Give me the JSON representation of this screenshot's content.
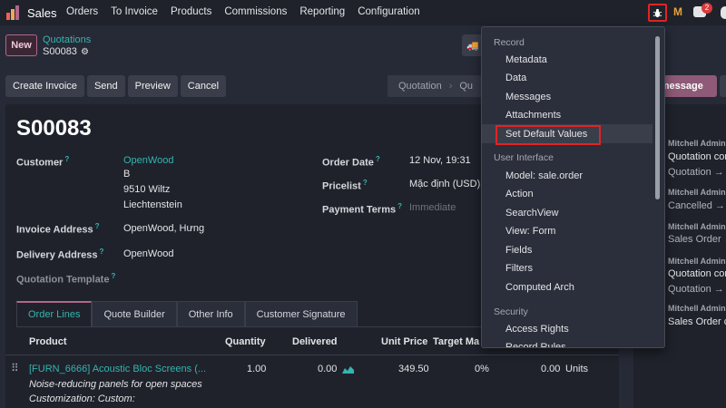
{
  "navbar": {
    "app_name": "Sales",
    "menu": [
      "Orders",
      "To Invoice",
      "Products",
      "Commissions",
      "Reporting",
      "Configuration"
    ],
    "debug_icon": "bug-icon",
    "m_icon_label": "M",
    "chat_badge": "2",
    "logo_colors": [
      "#f06050",
      "#f4a460",
      "#b0668c"
    ]
  },
  "control": {
    "new_label": "New",
    "breadcrumb_parent": "Quotations",
    "breadcrumb_current": "S00083",
    "actions": [
      "Create Invoice",
      "Send",
      "Preview",
      "Cancel"
    ],
    "status_stages": [
      "Quotation",
      "Qu"
    ],
    "send_message_label": "d message"
  },
  "form": {
    "record_name": "S00083",
    "labels": {
      "customer": "Customer",
      "invoice_address": "Invoice Address",
      "delivery_address": "Delivery Address",
      "quotation_template": "Quotation Template",
      "order_date": "Order Date",
      "pricelist": "Pricelist",
      "payment_terms": "Payment Terms"
    },
    "help_mark": "?",
    "customer": {
      "name": "OpenWood",
      "line1": "B",
      "line2": "9510 Wiltz",
      "line3": "Liechtenstein"
    },
    "invoice_address": "OpenWood, Hưng",
    "delivery_address": "OpenWood",
    "order_date": "12 Nov, 19:31",
    "pricelist": "Mặc định (USD)",
    "payment_terms_placeholder": "Immediate"
  },
  "tabs": [
    "Order Lines",
    "Quote Builder",
    "Other Info",
    "Customer Signature"
  ],
  "table": {
    "headers": [
      "Product",
      "Quantity",
      "Delivered",
      "Unit Price",
      "Target Ma"
    ],
    "row": {
      "product": "[FURN_6666] Acoustic Bloc Screens (...",
      "quantity": "1.00",
      "delivered": "0.00",
      "unit_price": "349.50",
      "target_margin": "0%",
      "subtotal": "0.00",
      "uom": "Units",
      "desc1": "Noise-reducing panels for open spaces",
      "desc2": "Customization: Custom:"
    }
  },
  "chatter": {
    "entries": [
      {
        "author": "Mitchell Admin",
        "text": "Quotation cor",
        "sub": "Quotation →"
      },
      {
        "author": "Mitchell Admin",
        "text": "Cancelled →"
      },
      {
        "author": "Mitchell Admin",
        "text": "Sales Order →"
      },
      {
        "author": "Mitchell Admin",
        "text": "Quotation cor",
        "sub": "Quotation →"
      },
      {
        "author": "Mitchell Admin",
        "text": "Sales Order cr"
      }
    ]
  },
  "debug_menu": {
    "sections": [
      {
        "header": "Record",
        "items": [
          "Metadata",
          "Data",
          "Messages",
          "Attachments",
          "Set Default Values"
        ]
      },
      {
        "header": "User Interface",
        "items": [
          "Model: sale.order",
          "Action",
          "SearchView",
          "View: Form",
          "Fields",
          "Filters",
          "Computed Arch"
        ]
      },
      {
        "header": "Security",
        "items": [
          "Access Rights",
          "Record Rules"
        ]
      }
    ],
    "highlighted_item": "Set Default Values"
  }
}
